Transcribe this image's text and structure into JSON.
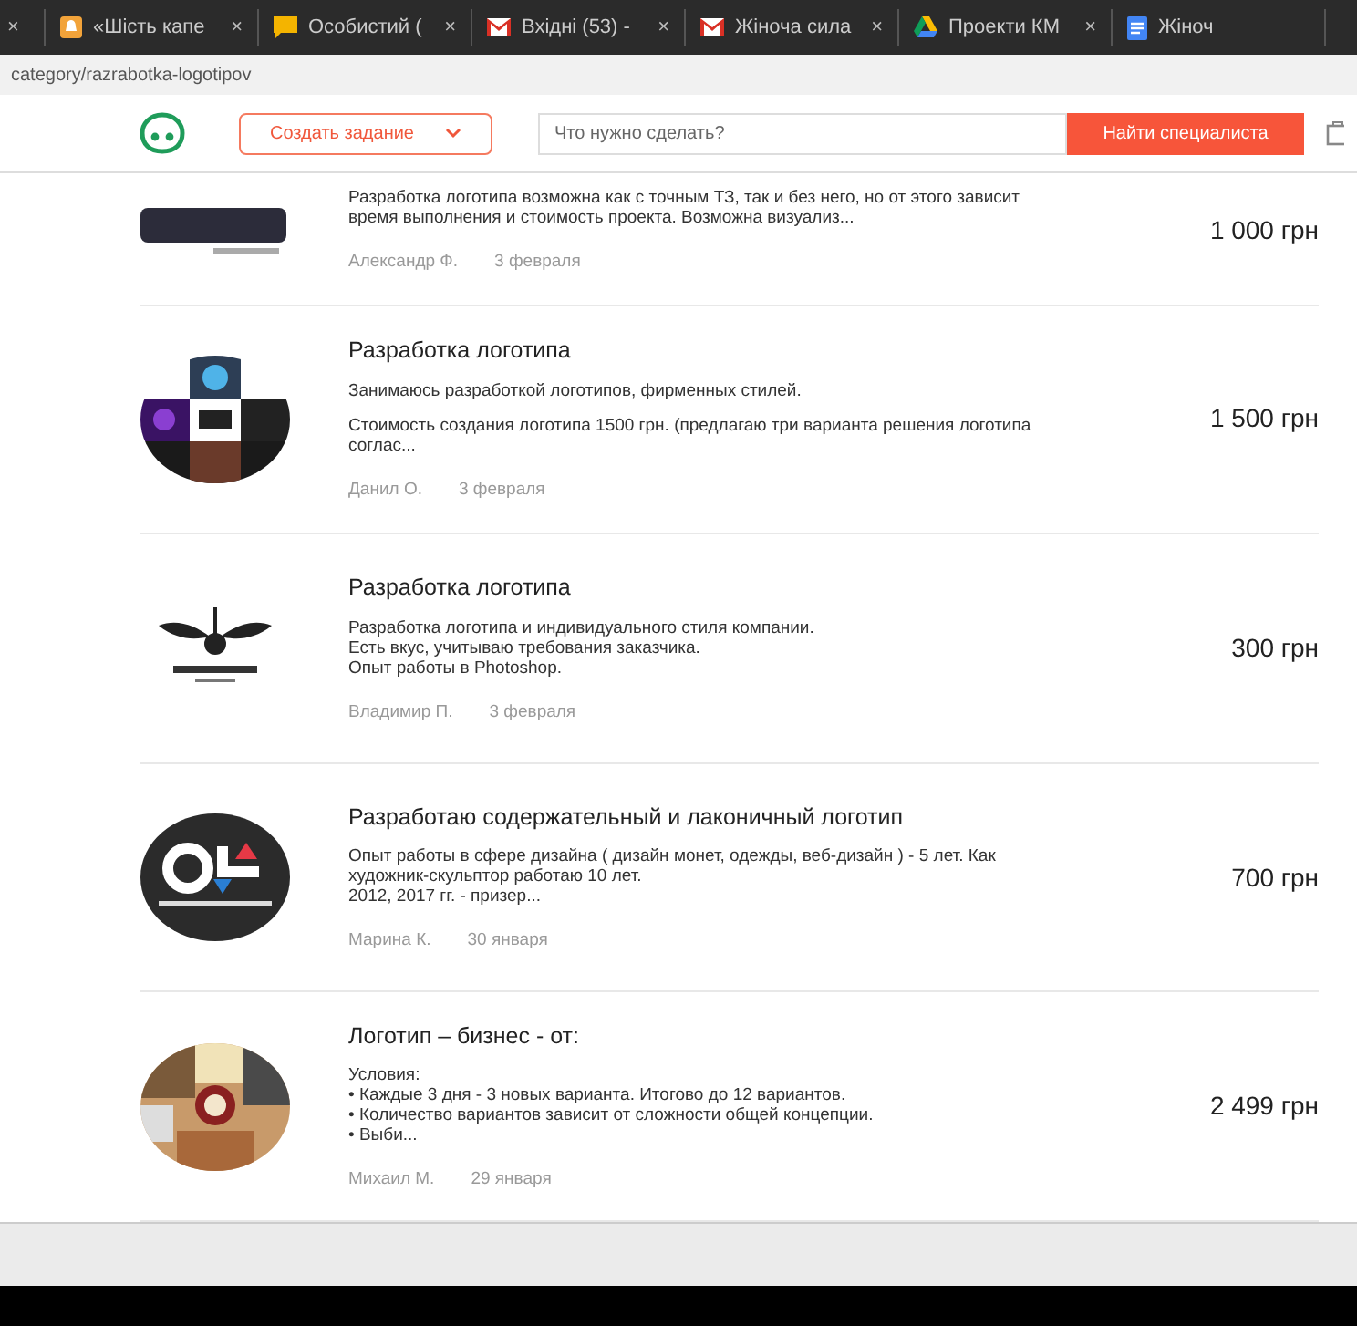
{
  "browser_tabs": [
    {
      "close": "×"
    },
    {
      "title": "«Шість капе",
      "close": "×"
    },
    {
      "title": "Особистий (",
      "close": "×"
    },
    {
      "title": "Вхідні (53) -",
      "close": "×"
    },
    {
      "title": "Жіноча сила",
      "close": "×"
    },
    {
      "title": "Проекти КМ",
      "close": "×"
    },
    {
      "title": "Жіноч"
    }
  ],
  "address": "category/razrabotka-logotipov",
  "header": {
    "create_button": "Создать задание",
    "search": {
      "placeholder": "Что нужно сделать?"
    },
    "find_button": "Найти специалиста"
  },
  "listings": [
    {
      "kind": "picture",
      "description": [
        "Разработка логотипа возможна как с точным ТЗ, так и без него, но от этого зависит время выполнения и стоимость проекта. Возможна визуализ..."
      ],
      "author": "Александр Ф.",
      "date": "3 февраля",
      "price": "1 000 грн"
    },
    {
      "kind": "picture",
      "title": "Разработка логотипа",
      "description": [
        "Занимаюсь разработкой логотипов, фирменных стилей.",
        "Стоимость создания логотипа 1500 грн. (предлагаю три варианта решения логотипа соглас..."
      ],
      "author": "Данил О.",
      "date": "3 февраля",
      "price": "1 500 грн"
    },
    {
      "kind": "picture",
      "title": "Разработка логотипа",
      "description": [
        "Разработка логотипа и индивидуального стиля компании.\nЕсть вкус, учитываю требования заказчика.\nОпыт работы в Photoshop."
      ],
      "author": "Владимир П.",
      "date": "3 февраля",
      "price": "300 грн"
    },
    {
      "kind": "picture",
      "title": "Разработаю содержательный и лаконичный логотип",
      "description": [
        "Опыт работы в сфере дизайна ( дизайн монет, одежды, веб-дизайн ) - 5 лет. Как художник-скульптор работаю 10 лет.\n2012, 2017 гг. - призер..."
      ],
      "author": "Марина К.",
      "date": "30 января",
      "price": "700 грн"
    },
    {
      "kind": "picture",
      "title": "Логотип – бизнес - от:",
      "description": [
        "Условия:\n• Каждые 3 дня - 3 новых варианта. Итогово до 12 вариантов.\n• Количество вариантов зависит от сложности общей концепции.\n• Выби..."
      ],
      "author": "Михаил М.",
      "date": "29 января",
      "price": "2 499 грн"
    }
  ]
}
